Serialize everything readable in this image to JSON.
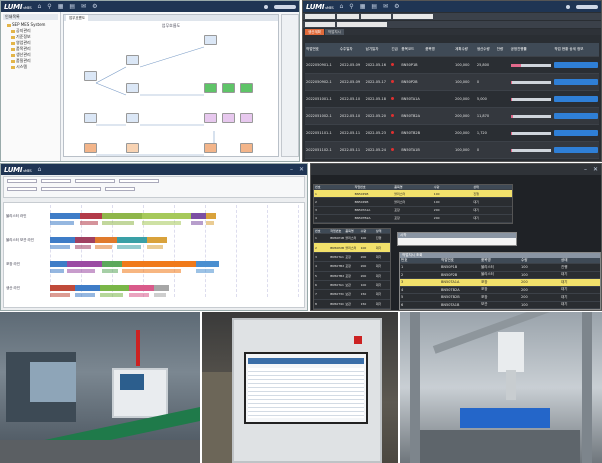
{
  "brand": {
    "logo_text": "LUMI",
    "logo_suffix": "vMES"
  },
  "colors": {
    "topbar": "#1f3554",
    "accent_orange": "#e06a3a",
    "accent_blue": "#2f7fd6",
    "highlight_yellow": "#f2e16b",
    "alert_red": "#e03030"
  },
  "icons": [
    "home-icon",
    "search-icon",
    "grid-icon",
    "document-icon",
    "mail-icon",
    "settings-icon",
    "close-icon",
    "minimize-icon"
  ],
  "workflow_screen": {
    "tree_header": "인쇄목록",
    "tree_items": [
      {
        "label": "SEP MES System",
        "level": 1
      },
      {
        "label": "공지관리",
        "level": 2
      },
      {
        "label": "기준정보",
        "level": 2
      },
      {
        "label": "영업관리",
        "level": 2
      },
      {
        "label": "품목관리",
        "level": 2
      },
      {
        "label": "생산관리",
        "level": 2
      },
      {
        "label": "품질관리",
        "level": 2
      },
      {
        "label": "시스템",
        "level": 2
      }
    ],
    "tabs": [
      "업무흐름도"
    ],
    "title": "업무흐름도"
  },
  "schedule_screen": {
    "sub_tabs": [
      "생산계획",
      "작업지시"
    ],
    "columns": [
      "작업번호",
      "수주일자",
      "납기일자",
      "긴급",
      "품목코드",
      "품목명",
      "계획수량",
      "생산수량",
      "잔량",
      "공정진행률",
      "작업 현황 상세 정보"
    ],
    "rows": [
      {
        "no": "2022050901-1",
        "date": "2022-05-09",
        "due": "2022-05-16",
        "code": "BN50P1B",
        "qty": "100,000",
        "done": "25,800",
        "progress": 0.26
      },
      {
        "no": "2022050902-1",
        "date": "2022-05-09",
        "due": "2022-05-17",
        "code": "BN50P2B",
        "qty": "100,000",
        "done": "0",
        "progress": 0.0
      },
      {
        "no": "2022051001-1",
        "date": "2022-05-10",
        "due": "2022-05-18",
        "code": "BN50TA1A",
        "qty": "200,000",
        "done": "5,000",
        "progress": 0.03
      },
      {
        "no": "2022051002-1",
        "date": "2022-05-10",
        "due": "2022-05-20",
        "code": "BN50TB2A",
        "qty": "200,000",
        "done": "11,870",
        "progress": 0.06
      },
      {
        "no": "2022051101-1",
        "date": "2022-05-11",
        "due": "2022-05-23",
        "code": "BN50TB2B",
        "qty": "200,000",
        "done": "1,720",
        "progress": 0.01
      },
      {
        "no": "2022051102-1",
        "date": "2022-05-11",
        "due": "2022-05-24",
        "code": "BN50TA1B",
        "qty": "100,000",
        "done": "0",
        "progress": 0.0
      }
    ]
  },
  "gantt_screen": {
    "lines": [
      {
        "label": "블리스터 라인",
        "segments": [
          {
            "start": 0.0,
            "len": 0.12,
            "color": "#3e7cc7"
          },
          {
            "start": 0.12,
            "len": 0.09,
            "color": "#b23a48"
          },
          {
            "start": 0.21,
            "len": 0.16,
            "color": "#8fb64a"
          },
          {
            "start": 0.37,
            "len": 0.2,
            "color": "#a6c95a"
          },
          {
            "start": 0.57,
            "len": 0.06,
            "color": "#7c4fa3"
          },
          {
            "start": 0.63,
            "len": 0.04,
            "color": "#d9a23b"
          }
        ]
      },
      {
        "label": "블리스터 보관 라인",
        "segments": [
          {
            "start": 0.0,
            "len": 0.1,
            "color": "#3e7cc7"
          },
          {
            "start": 0.1,
            "len": 0.08,
            "color": "#a04060"
          },
          {
            "start": 0.18,
            "len": 0.09,
            "color": "#e07a2c"
          },
          {
            "start": 0.27,
            "len": 0.12,
            "color": "#3aa0a6"
          },
          {
            "start": 0.39,
            "len": 0.08,
            "color": "#d9a23b"
          }
        ]
      },
      {
        "label": "포장 라인",
        "segments": [
          {
            "start": 0.0,
            "len": 0.07,
            "color": "#3e7cc7"
          },
          {
            "start": 0.07,
            "len": 0.14,
            "color": "#9b4aa3"
          },
          {
            "start": 0.21,
            "len": 0.08,
            "color": "#5ca85c"
          },
          {
            "start": 0.29,
            "len": 0.3,
            "color": "#f07a1a"
          },
          {
            "start": 0.59,
            "len": 0.09,
            "color": "#4a8fd0"
          }
        ]
      },
      {
        "label": "생산 라인",
        "segments": [
          {
            "start": 0.0,
            "len": 0.1,
            "color": "#c04a3a"
          },
          {
            "start": 0.1,
            "len": 0.1,
            "color": "#3e7cc7"
          },
          {
            "start": 0.2,
            "len": 0.12,
            "color": "#7ab648"
          },
          {
            "start": 0.32,
            "len": 0.1,
            "color": "#d95a8a"
          },
          {
            "start": 0.42,
            "len": 0.06,
            "color": "#a6a6a6"
          }
        ]
      }
    ]
  },
  "monitor_screen": {
    "popup_title": "작업지시 조회",
    "dialog_label": "시작",
    "columns": [
      "번호",
      "작업번호",
      "품목명",
      "수량",
      "상태"
    ],
    "rows": [
      {
        "no": "1",
        "id": "BN50P1B",
        "name": "블리스터",
        "qty": "100",
        "state": "진행"
      },
      {
        "no": "2",
        "id": "BN50P2B",
        "name": "블리스터",
        "qty": "100",
        "state": "대기"
      },
      {
        "no": "3",
        "id": "BN50TA1A",
        "name": "포장",
        "qty": "200",
        "state": "대기"
      },
      {
        "no": "4",
        "id": "BN50TB2A",
        "name": "포장",
        "qty": "200",
        "state": "대기"
      },
      {
        "no": "5",
        "id": "BN50TB2B",
        "name": "포장",
        "qty": "200",
        "state": "대기"
      },
      {
        "no": "6",
        "id": "BN50TA1B",
        "name": "보관",
        "qty": "100",
        "state": "대기"
      },
      {
        "no": "7",
        "id": "BN50T3C",
        "name": "보관",
        "qty": "150",
        "state": "대기"
      },
      {
        "no": "8",
        "id": "BN50T4C",
        "name": "보관",
        "qty": "150",
        "state": "대기"
      }
    ]
  }
}
